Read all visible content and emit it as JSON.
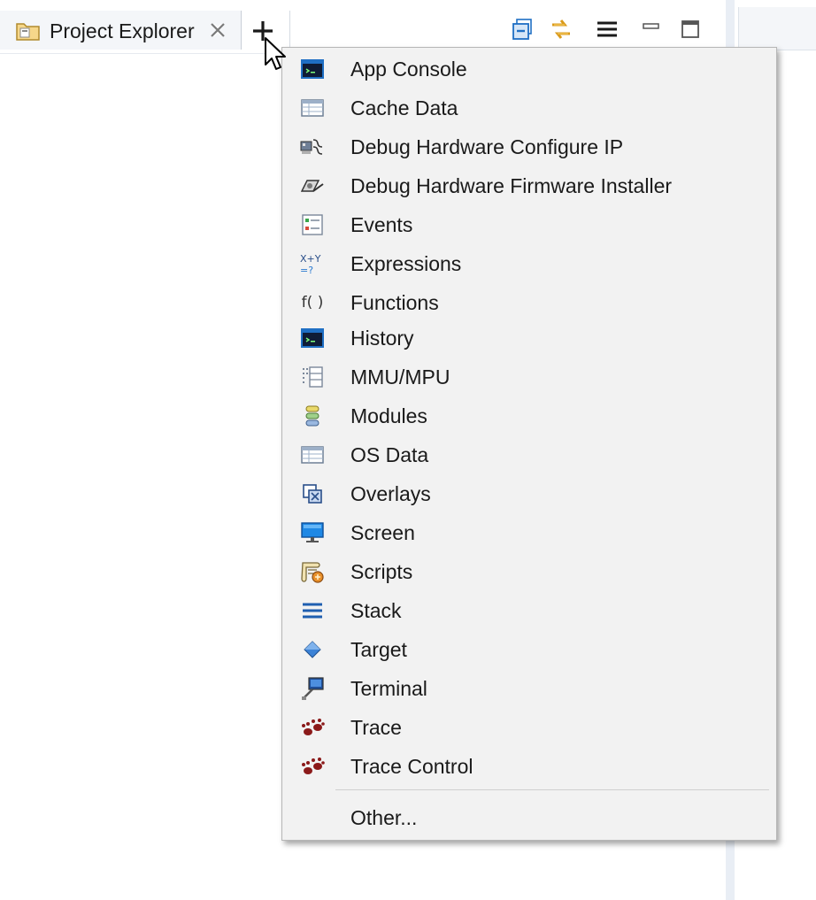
{
  "tab": {
    "title": "Project Explorer",
    "folder_icon": "folder-project-icon",
    "close_icon": "close-icon"
  },
  "toolbar": {
    "add_icon": "plus-icon",
    "collapse_icon": "collapse-all-icon",
    "link_icon": "link-with-editor-icon",
    "menu_icon": "view-menu-icon",
    "minimize_icon": "minimize-icon",
    "maximize_icon": "maximize-icon"
  },
  "menu": {
    "items": [
      {
        "label": "App Console",
        "icon": "console-icon"
      },
      {
        "label": "Cache Data",
        "icon": "table-icon"
      },
      {
        "label": "Debug Hardware Configure IP",
        "icon": "hardware-config-icon"
      },
      {
        "label": "Debug Hardware Firmware Installer",
        "icon": "firmware-installer-icon"
      },
      {
        "label": "Events",
        "icon": "events-icon"
      },
      {
        "label": "Expressions",
        "icon": "expressions-icon"
      },
      {
        "label": "Functions",
        "icon": "functions-icon"
      },
      {
        "label": "History",
        "icon": "console-icon"
      },
      {
        "label": "MMU/MPU",
        "icon": "mmu-icon"
      },
      {
        "label": "Modules",
        "icon": "modules-icon"
      },
      {
        "label": "OS Data",
        "icon": "table-icon"
      },
      {
        "label": "Overlays",
        "icon": "overlays-icon"
      },
      {
        "label": "Screen",
        "icon": "monitor-icon"
      },
      {
        "label": "Scripts",
        "icon": "scripts-icon"
      },
      {
        "label": "Stack",
        "icon": "stack-icon"
      },
      {
        "label": "Target",
        "icon": "target-diamond-icon"
      },
      {
        "label": "Terminal",
        "icon": "terminal-icon"
      },
      {
        "label": "Trace",
        "icon": "trace-paw-icon"
      },
      {
        "label": "Trace Control",
        "icon": "trace-paw-icon"
      }
    ],
    "other_label": "Other...",
    "functions_glyph": "f( )"
  },
  "colors": {
    "menu_bg": "#f2f2f2",
    "accent_blue": "#1f6fc4",
    "trace_red": "#8b1a1a"
  }
}
